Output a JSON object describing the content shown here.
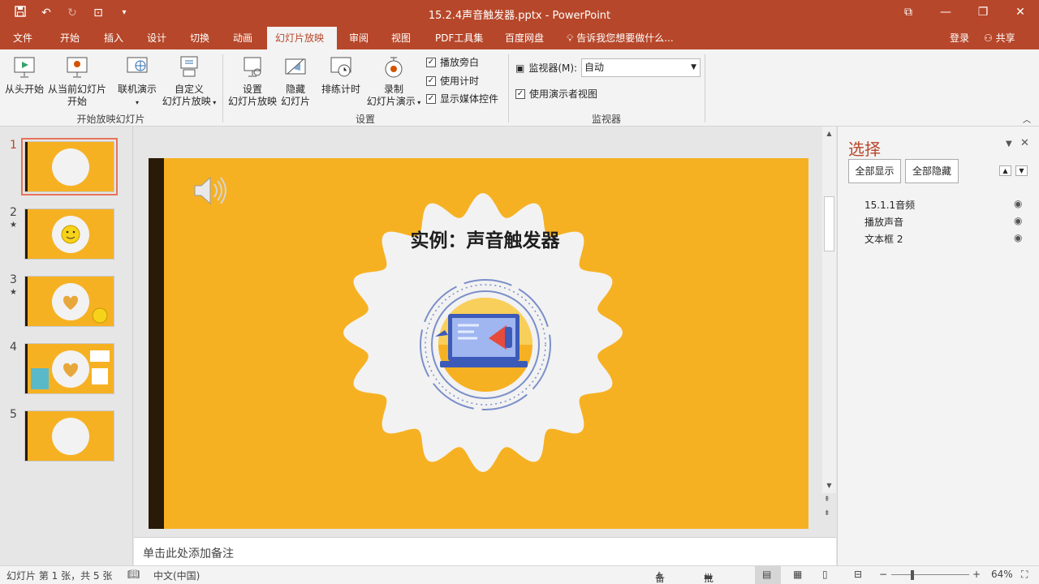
{
  "window": {
    "title": "15.2.4声音触发器.pptx - PowerPoint",
    "qat_icons": [
      "save-icon",
      "undo-icon",
      "redo-icon",
      "start-from-beginning-icon",
      "customize-qat-icon"
    ],
    "controls": [
      "ribbon-display-icon",
      "minimize-icon",
      "restore-icon",
      "close-icon"
    ]
  },
  "tabs": {
    "items": [
      "文件",
      "开始",
      "插入",
      "设计",
      "切换",
      "动画",
      "幻灯片放映",
      "审阅",
      "视图",
      "PDF工具集",
      "百度网盘"
    ],
    "active": "幻灯片放映",
    "tell_me": "告诉我您想要做什么...",
    "login": "登录",
    "share": "共享"
  },
  "ribbon": {
    "from_beginning": "从头开始",
    "from_current_line1": "从当前幻灯片",
    "from_current_line2": "开始",
    "online_present": "联机演示",
    "custom_line1": "自定义",
    "custom_line2": "幻灯片放映",
    "group_start": "开始放映幻灯片",
    "setup_line1": "设置",
    "setup_line2": "幻灯片放映",
    "hide_line1": "隐藏",
    "hide_line2": "幻灯片",
    "rehearse": "排练计时",
    "record_line1": "录制",
    "record_line2": "幻灯片演示",
    "chk_narration": "播放旁白",
    "chk_timings": "使用计时",
    "chk_media": "显示媒体控件",
    "group_setup": "设置",
    "monitor_label": "监视器(M):",
    "monitor_value": "自动",
    "presenter_view": "使用演示者视图",
    "group_monitor": "监视器"
  },
  "thumbnails": [
    {
      "num": "1",
      "star": ""
    },
    {
      "num": "2",
      "star": "★"
    },
    {
      "num": "3",
      "star": "★"
    },
    {
      "num": "4",
      "star": ""
    },
    {
      "num": "5",
      "star": ""
    }
  ],
  "slide": {
    "title": "实例：声音触发器",
    "background": "#f6b123",
    "bar_color": "#2a1a08"
  },
  "notes": {
    "placeholder": "单击此处添加备注"
  },
  "selection_pane": {
    "title": "选择",
    "show_all": "全部显示",
    "hide_all": "全部隐藏",
    "items": [
      "15.1.1音频",
      "播放声音",
      "文本框 2"
    ]
  },
  "status": {
    "slide_info": "幻灯片 第 1 张，共 5 张",
    "language": "中文(中国)",
    "notes_btn": "备注",
    "comments_btn": "批注",
    "zoom": "64%"
  }
}
